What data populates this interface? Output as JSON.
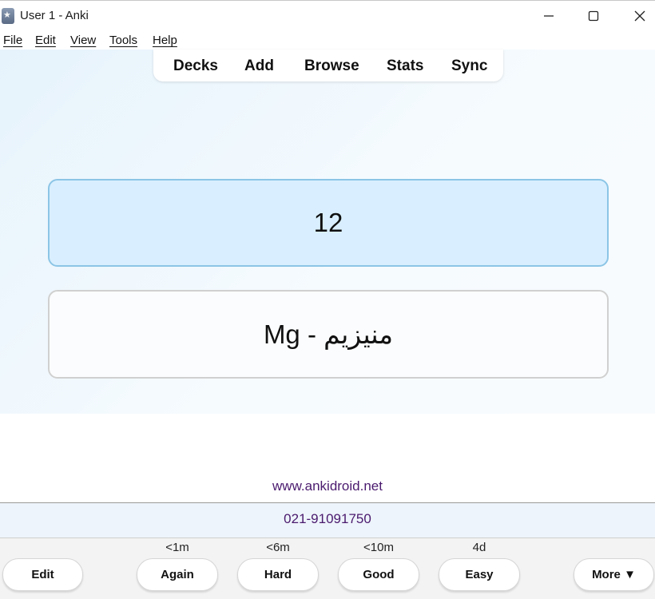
{
  "window": {
    "title": "User 1 - Anki",
    "controls": {
      "minimize_icon": "minimize-icon",
      "maximize_icon": "maximize-icon",
      "close_icon": "close-icon"
    }
  },
  "menu": [
    "File",
    "Edit",
    "View",
    "Tools",
    "Help"
  ],
  "toolbar": {
    "items": [
      "Decks",
      "Add",
      "Browse",
      "Stats",
      "Sync"
    ]
  },
  "card": {
    "question": "12",
    "answer": "Mg - منيزيم"
  },
  "footer": {
    "website": "www.ankidroid.net",
    "phone": "021-91091750"
  },
  "answer_bar": {
    "edit_label": "Edit",
    "buttons": [
      {
        "label": "Again",
        "interval": "<1m"
      },
      {
        "label": "Hard",
        "interval": "<6m"
      },
      {
        "label": "Good",
        "interval": "<10m"
      },
      {
        "label": "Easy",
        "interval": "4d"
      }
    ],
    "more_label": "More ▼"
  },
  "colors": {
    "question_bg": "#d9efff",
    "question_border": "#8cc5e6",
    "footer_text": "#4a1a6e"
  }
}
